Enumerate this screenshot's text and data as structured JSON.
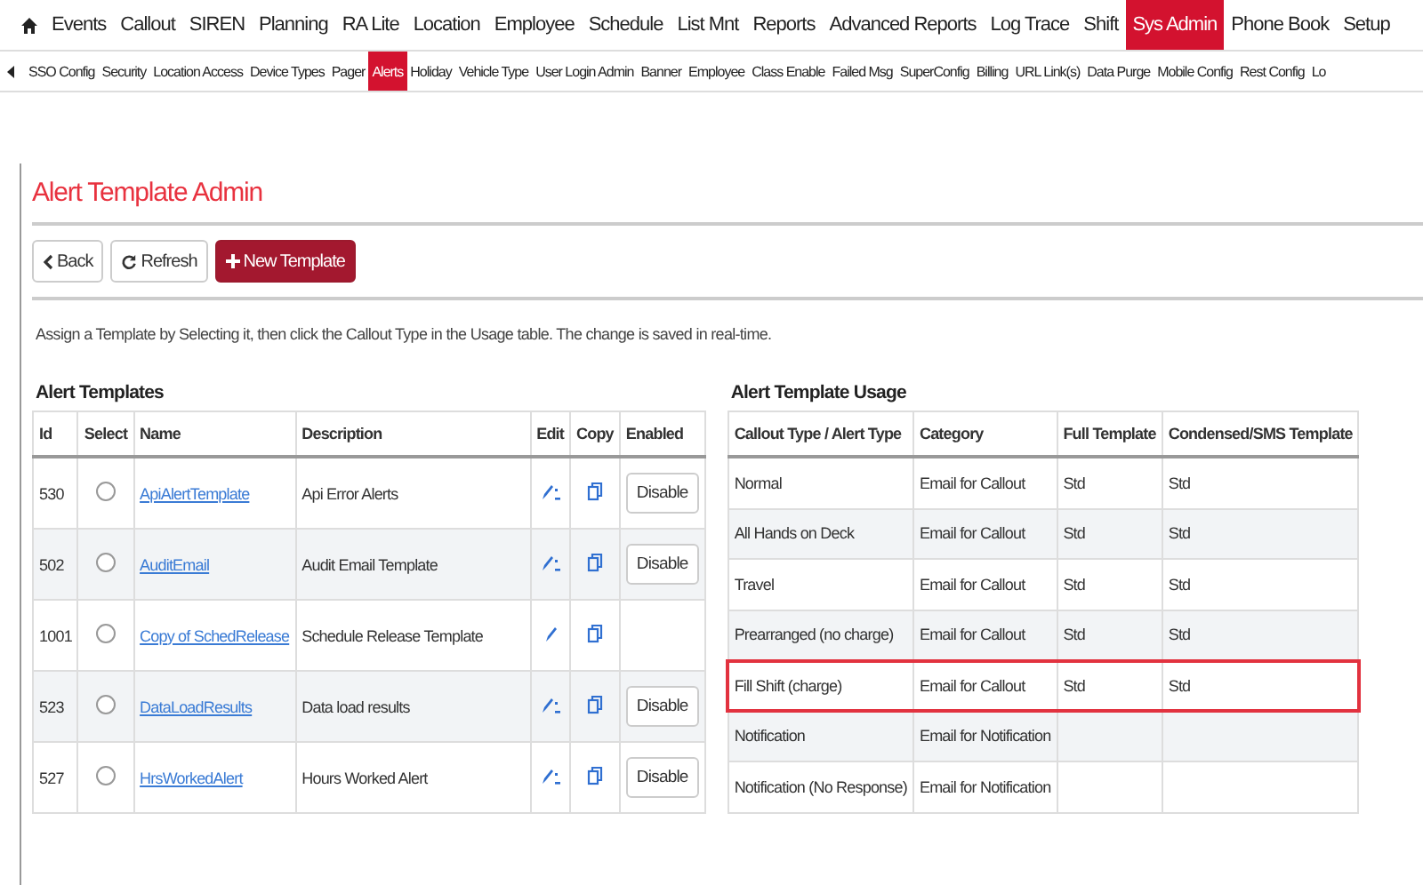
{
  "top_nav": [
    {
      "label": "Events",
      "selected": false
    },
    {
      "label": "Callout",
      "selected": false
    },
    {
      "label": "SIREN",
      "selected": false
    },
    {
      "label": "Planning",
      "selected": false
    },
    {
      "label": "RA Lite",
      "selected": false
    },
    {
      "label": "Location",
      "selected": false
    },
    {
      "label": "Employee",
      "selected": false
    },
    {
      "label": "Schedule",
      "selected": false
    },
    {
      "label": "List Mnt",
      "selected": false
    },
    {
      "label": "Reports",
      "selected": false
    },
    {
      "label": "Advanced Reports",
      "selected": false
    },
    {
      "label": "Log Trace",
      "selected": false
    },
    {
      "label": "Shift",
      "selected": false
    },
    {
      "label": "Sys Admin",
      "selected": true
    },
    {
      "label": "Phone Book",
      "selected": false
    },
    {
      "label": "Setup",
      "selected": false
    }
  ],
  "sub_nav": [
    {
      "label": "SSO Config",
      "selected": false
    },
    {
      "label": "Security",
      "selected": false
    },
    {
      "label": "Location Access",
      "selected": false
    },
    {
      "label": "Device Types",
      "selected": false
    },
    {
      "label": "Pager",
      "selected": false
    },
    {
      "label": "Alerts",
      "selected": true
    },
    {
      "label": "Holiday",
      "selected": false
    },
    {
      "label": "Vehicle Type",
      "selected": false
    },
    {
      "label": "User Login Admin",
      "selected": false
    },
    {
      "label": "Banner",
      "selected": false
    },
    {
      "label": "Employee",
      "selected": false
    },
    {
      "label": "Class Enable",
      "selected": false
    },
    {
      "label": "Failed Msg",
      "selected": false
    },
    {
      "label": "SuperConfig",
      "selected": false
    },
    {
      "label": "Billing",
      "selected": false
    },
    {
      "label": "URL Link(s)",
      "selected": false
    },
    {
      "label": "Data Purge",
      "selected": false
    },
    {
      "label": "Mobile Config",
      "selected": false
    },
    {
      "label": "Rest Config",
      "selected": false
    },
    {
      "label": "Lo",
      "selected": false
    }
  ],
  "page_title": "Alert Template Admin",
  "toolbar": [
    {
      "kind": "back",
      "label": "Back"
    },
    {
      "kind": "refresh",
      "label": "Refresh"
    },
    {
      "kind": "new",
      "label": "New Template"
    }
  ],
  "instructions": "Assign a Template by Selecting it, then click the Callout Type in the Usage table. The change is saved in real-time.",
  "templates": {
    "title": "Alert Templates",
    "columns": [
      "Id",
      "Select",
      "Name",
      "Description",
      "Edit",
      "Copy",
      "Enabled"
    ],
    "rows": [
      {
        "id": "530",
        "selected": false,
        "name": "ApiAlertTemplate",
        "description": "Api Error Alerts",
        "edit_badge": true,
        "enabled_button": "Disable"
      },
      {
        "id": "502",
        "selected": false,
        "name": "AuditEmail",
        "description": "Audit Email Template",
        "edit_badge": true,
        "enabled_button": "Disable"
      },
      {
        "id": "1001",
        "selected": false,
        "name": "Copy of SchedRelease",
        "description": "Schedule Release Template",
        "edit_badge": false
      },
      {
        "id": "523",
        "selected": false,
        "name": "DataLoadResults",
        "description": "Data load results",
        "edit_badge": true,
        "enabled_button": "Disable"
      },
      {
        "id": "527",
        "selected": false,
        "name": "HrsWorkedAlert",
        "description": "Hours Worked Alert",
        "edit_badge": true,
        "enabled_button": "Disable"
      }
    ]
  },
  "usage": {
    "title": "Alert Template Usage",
    "columns": [
      "Callout Type / Alert Type",
      "Category",
      "Full Template",
      "Condensed/SMS Template"
    ],
    "rows": [
      {
        "cells": [
          "Normal",
          "Email for Callout",
          "Std",
          "Std"
        ],
        "highlighted": false
      },
      {
        "cells": [
          "All Hands on Deck",
          "Email for Callout",
          "Std",
          "Std"
        ],
        "highlighted": false
      },
      {
        "cells": [
          "Travel",
          "Email for Callout",
          "Std",
          "Std"
        ],
        "highlighted": false
      },
      {
        "cells": [
          "Prearranged (no charge)",
          "Email for Callout",
          "Std",
          "Std"
        ],
        "highlighted": false
      },
      {
        "cells": [
          "Fill Shift (charge)",
          "Email for Callout",
          "Std",
          "Std"
        ],
        "highlighted": true
      },
      {
        "cells": [
          "Notification",
          "Email for Notification"
        ],
        "highlighted": false
      },
      {
        "cells": [
          "Notification (No Response)",
          "Email for Notification"
        ],
        "highlighted": false
      }
    ]
  }
}
